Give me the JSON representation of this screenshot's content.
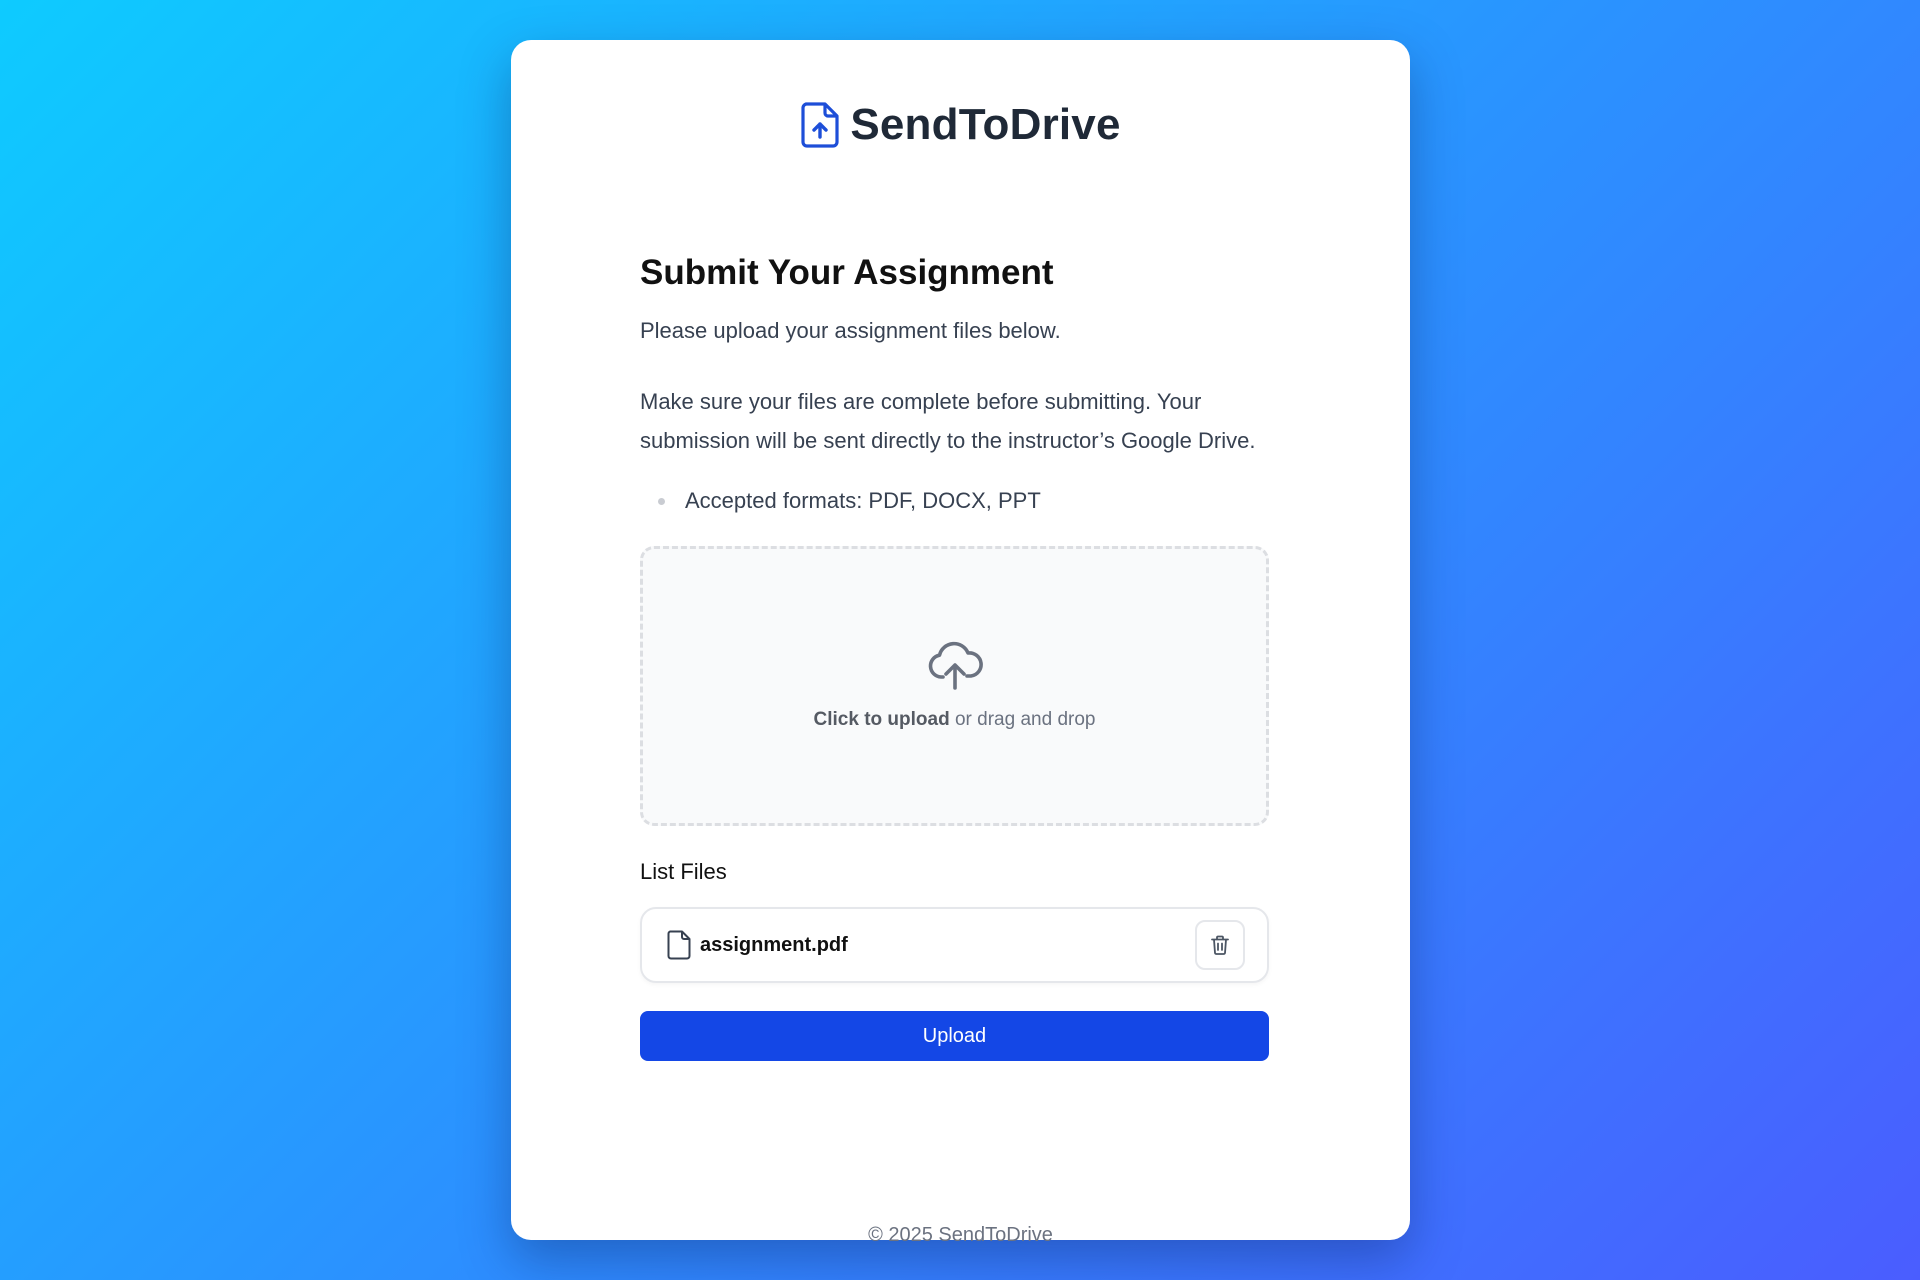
{
  "app": {
    "name": "SendToDrive",
    "logo_icon": "file-upload-icon",
    "accent_color": "#1447e6"
  },
  "main": {
    "title": "Submit Your Assignment",
    "subtitle": "Please upload your assignment files below.",
    "description": "Make sure your files are complete before submitting. Your submission will be sent directly to the instructor’s Google Drive.",
    "formats": [
      "Accepted formats: PDF, DOCX, PPT"
    ]
  },
  "dropzone": {
    "icon": "cloud-upload-icon",
    "click_label": "Click to upload",
    "drag_label": " or drag and drop"
  },
  "files": {
    "title": "List Files",
    "items": [
      {
        "name": "assignment.pdf",
        "icon": "file-icon",
        "action_icon": "trash-icon"
      }
    ]
  },
  "actions": {
    "upload_label": "Upload"
  },
  "footer": {
    "text": "© 2025 SendToDrive"
  }
}
